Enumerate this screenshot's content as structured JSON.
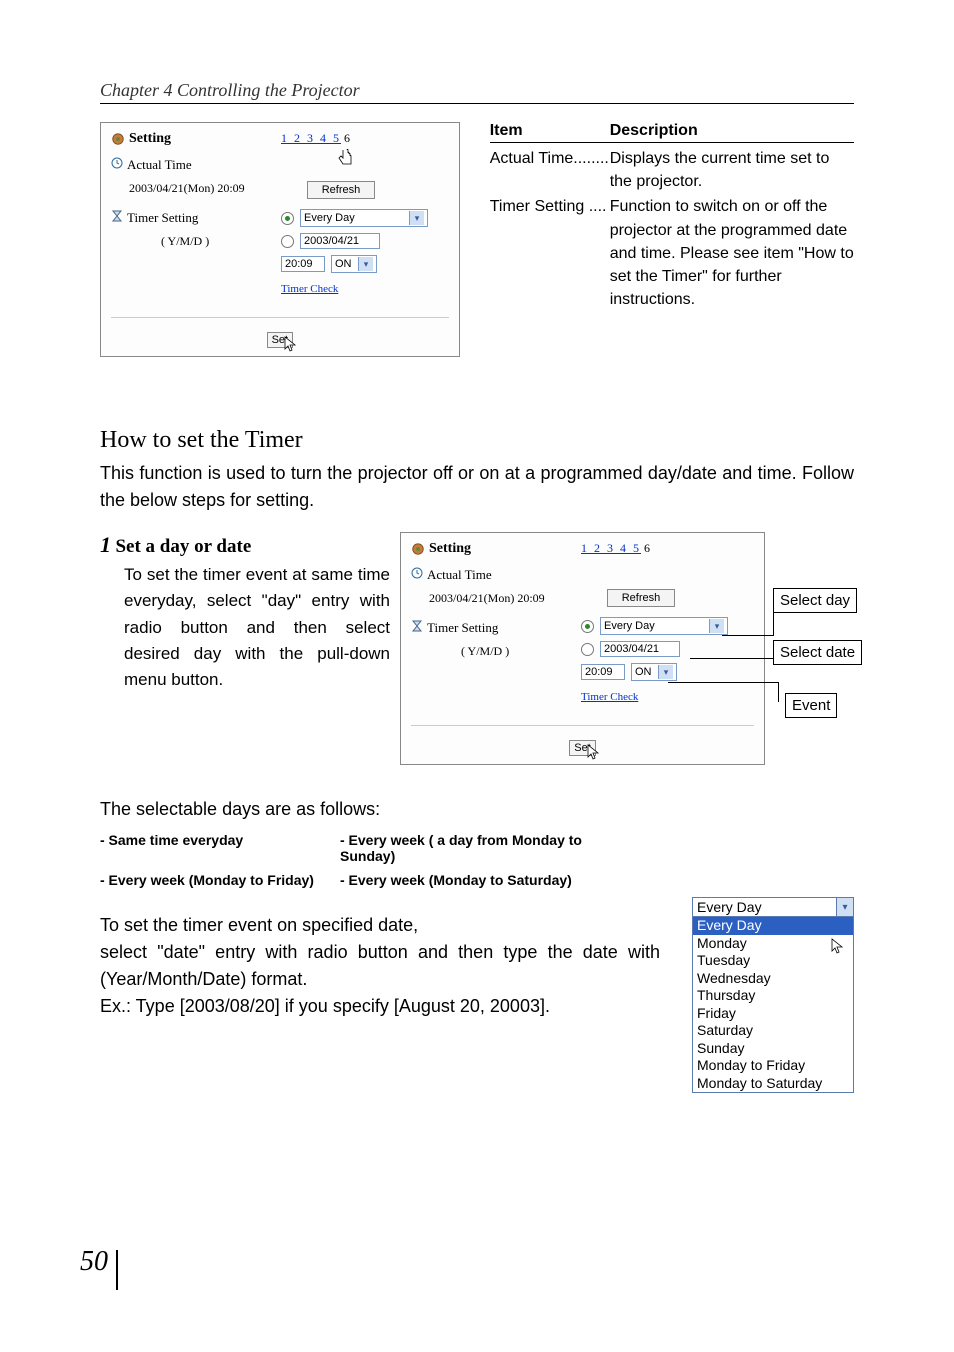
{
  "chapter_heading": "Chapter 4 Controlling the Projector",
  "page_number": "50",
  "screenshot1": {
    "title": "Setting",
    "actual_time_label": "Actual Time",
    "actual_time_value": "2003/04/21(Mon) 20:09",
    "timer_setting_label": "Timer Setting",
    "ymd_label": "( Y/M/D )",
    "page_links_prefix": "1 2 3 4 5",
    "page_links_current": "6",
    "refresh_btn": "Refresh",
    "day_value": "Every Day",
    "date_value": "2003/04/21",
    "time_value": "20:09",
    "onoff_value": "ON",
    "timer_check_link": "Timer Check",
    "set_btn": "Set"
  },
  "desc": {
    "header_item": "Item",
    "header_desc": "Description",
    "row1_item": "Actual Time........",
    "row1_desc": "Displays the current time set to the projector.",
    "row2_item": "Timer Setting ....",
    "row2_desc": "Function to switch on or off the projector at the programmed date and time. Please see item \"How to set the Timer\" for further instructions."
  },
  "section_title": "How to set the Timer",
  "section_intro": "This function is used to turn the projector off or on at a programmed day/date and time. Follow the below steps for setting.",
  "step1": {
    "num": "1",
    "title": "Set a day or date",
    "body": "To set the timer event at same time everyday,\nselect \"day\" entry with radio button and then select desired day with the pull-down menu button."
  },
  "screenshot2": {
    "title": "Setting",
    "actual_time_label": "Actual Time",
    "actual_time_value": "2003/04/21(Mon) 20:09",
    "timer_setting_label": "Timer Setting",
    "ymd_label": "( Y/M/D )",
    "page_links_prefix": "1 2 3 4 5",
    "page_links_current": "6",
    "refresh_btn": "Refresh",
    "day_value": "Every Day",
    "date_value": "2003/04/21",
    "time_value": "20:09",
    "onoff_value": "ON",
    "timer_check_link": "Timer Check",
    "set_btn": "Set",
    "callout_day": "Select day",
    "callout_date": "Select date",
    "callout_event": "Event"
  },
  "selectable_days_line": "The selectable days are as follows:",
  "days_grid": {
    "a1": "- Same time everyday",
    "a2": "- Every week ( a day from Monday to Sunday)",
    "b1": "- Every week (Monday to Friday)",
    "b2": "- Every week (Monday to Saturday)"
  },
  "date_instr_1": "To set the timer event on specified date,",
  "date_instr_2": "select \"date\" entry with radio button and then type the date with (Year/Month/Date) format.",
  "date_instr_3": "Ex.: Type [2003/08/20] if you specify [August 20, 20003].",
  "dd_list": {
    "current": "Every Day",
    "items": [
      "Every Day",
      "Monday",
      "Tuesday",
      "Wednesday",
      "Thursday",
      "Friday",
      "Saturday",
      "Sunday",
      "Monday to Friday",
      "Monday to Saturday"
    ],
    "selected_index": 0
  }
}
